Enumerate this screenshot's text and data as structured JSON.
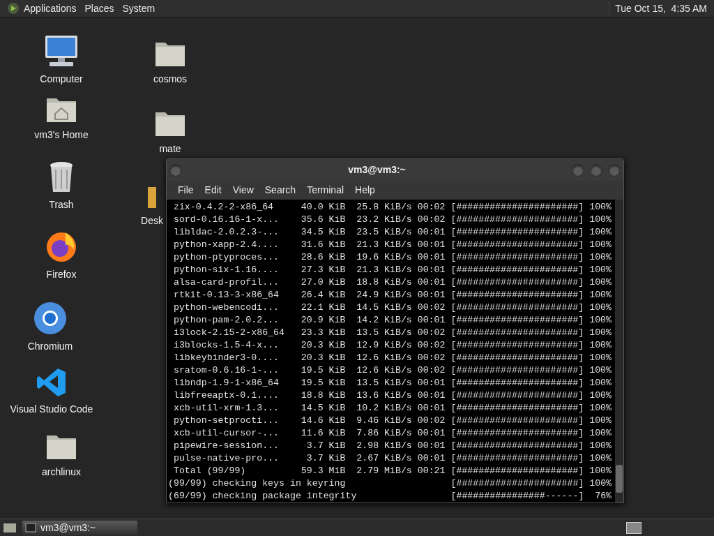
{
  "top_panel": {
    "menus": [
      "Applications",
      "Places",
      "System"
    ],
    "clock": "Tue Oct 15,  4:35 AM"
  },
  "desktop_icons": [
    {
      "label": "Computer",
      "kind": "monitor"
    },
    {
      "label": "vm3's Home",
      "kind": "home"
    },
    {
      "label": "Trash",
      "kind": "trash"
    },
    {
      "label": "Firefox",
      "kind": "flame"
    },
    {
      "label": "Chromium",
      "kind": "ring"
    },
    {
      "label": "Visual Studio Code",
      "kind": "ribbon"
    },
    {
      "label": "archlinux",
      "kind": "folder"
    },
    {
      "label": "cosmos",
      "kind": "folder"
    },
    {
      "label": "mate",
      "kind": "folder"
    },
    {
      "label": "Desk",
      "kind": "open-folder"
    }
  ],
  "terminal": {
    "title": "vm3@vm3:~",
    "menu": [
      "File",
      "Edit",
      "View",
      "Search",
      "Terminal",
      "Help"
    ],
    "rows": [
      {
        "kind": "transfer",
        "name": "zix-0.4.2-2-x86_64",
        "size": "40.0 KiB",
        "speed": "25.8 KiB/s",
        "time": "00:02",
        "bar": "[######################]",
        "percent": "100%"
      },
      {
        "kind": "transfer",
        "name": "sord-0.16.16-1-x...",
        "size": "35.6 KiB",
        "speed": "23.2 KiB/s",
        "time": "00:02",
        "bar": "[######################]",
        "percent": "100%"
      },
      {
        "kind": "transfer",
        "name": "libldac-2.0.2.3-...",
        "size": "34.5 KiB",
        "speed": "23.5 KiB/s",
        "time": "00:01",
        "bar": "[######################]",
        "percent": "100%"
      },
      {
        "kind": "transfer",
        "name": "python-xapp-2.4....",
        "size": "31.6 KiB",
        "speed": "21.3 KiB/s",
        "time": "00:01",
        "bar": "[######################]",
        "percent": "100%"
      },
      {
        "kind": "transfer",
        "name": "python-ptyproces...",
        "size": "28.6 KiB",
        "speed": "19.6 KiB/s",
        "time": "00:01",
        "bar": "[######################]",
        "percent": "100%"
      },
      {
        "kind": "transfer",
        "name": "python-six-1.16....",
        "size": "27.3 KiB",
        "speed": "21.3 KiB/s",
        "time": "00:01",
        "bar": "[######################]",
        "percent": "100%"
      },
      {
        "kind": "transfer",
        "name": "alsa-card-profil...",
        "size": "27.0 KiB",
        "speed": "18.8 KiB/s",
        "time": "00:01",
        "bar": "[######################]",
        "percent": "100%"
      },
      {
        "kind": "transfer",
        "name": "rtkit-0.13-3-x86_64",
        "size": "26.4 KiB",
        "speed": "24.9 KiB/s",
        "time": "00:01",
        "bar": "[######################]",
        "percent": "100%"
      },
      {
        "kind": "transfer",
        "name": "python-webencodi...",
        "size": "22.1 KiB",
        "speed": "14.5 KiB/s",
        "time": "00:02",
        "bar": "[######################]",
        "percent": "100%"
      },
      {
        "kind": "transfer",
        "name": "python-pam-2.0.2...",
        "size": "20.9 KiB",
        "speed": "14.2 KiB/s",
        "time": "00:01",
        "bar": "[######################]",
        "percent": "100%"
      },
      {
        "kind": "transfer",
        "name": "i3lock-2.15-2-x86_64",
        "size": "23.3 KiB",
        "speed": "13.5 KiB/s",
        "time": "00:02",
        "bar": "[######################]",
        "percent": "100%"
      },
      {
        "kind": "transfer",
        "name": "i3blocks-1.5-4-x...",
        "size": "20.3 KiB",
        "speed": "12.9 KiB/s",
        "time": "00:02",
        "bar": "[######################]",
        "percent": "100%"
      },
      {
        "kind": "transfer",
        "name": "libkeybinder3-0....",
        "size": "20.3 KiB",
        "speed": "12.6 KiB/s",
        "time": "00:02",
        "bar": "[######################]",
        "percent": "100%"
      },
      {
        "kind": "transfer",
        "name": "sratom-0.6.16-1-...",
        "size": "19.5 KiB",
        "speed": "12.6 KiB/s",
        "time": "00:02",
        "bar": "[######################]",
        "percent": "100%"
      },
      {
        "kind": "transfer",
        "name": "libndp-1.9-1-x86_64",
        "size": "19.5 KiB",
        "speed": "13.5 KiB/s",
        "time": "00:01",
        "bar": "[######################]",
        "percent": "100%"
      },
      {
        "kind": "transfer",
        "name": "libfreeaptx-0.1....",
        "size": "18.8 KiB",
        "speed": "13.6 KiB/s",
        "time": "00:01",
        "bar": "[######################]",
        "percent": "100%"
      },
      {
        "kind": "transfer",
        "name": "xcb-util-xrm-1.3...",
        "size": "14.5 KiB",
        "speed": "10.2 KiB/s",
        "time": "00:01",
        "bar": "[######################]",
        "percent": "100%"
      },
      {
        "kind": "transfer",
        "name": "python-setprocti...",
        "size": "14.6 KiB",
        "speed": "9.46 KiB/s",
        "time": "00:02",
        "bar": "[######################]",
        "percent": "100%"
      },
      {
        "kind": "transfer",
        "name": "xcb-util-cursor-...",
        "size": "11.6 KiB",
        "speed": "7.86 KiB/s",
        "time": "00:01",
        "bar": "[######################]",
        "percent": "100%"
      },
      {
        "kind": "transfer",
        "name": "pipewire-session...",
        "size": "3.7 KiB",
        "speed": "2.98 KiB/s",
        "time": "00:01",
        "bar": "[######################]",
        "percent": "100%"
      },
      {
        "kind": "transfer",
        "name": "pulse-native-pro...",
        "size": "3.7 KiB",
        "speed": "2.67 KiB/s",
        "time": "00:01",
        "bar": "[######################]",
        "percent": "100%"
      },
      {
        "kind": "transfer",
        "name": "Total (99/99)",
        "size": "59.3 MiB",
        "speed": "2.79 MiB/s",
        "time": "00:21",
        "bar": "[######################]",
        "percent": "100%"
      },
      {
        "kind": "check",
        "text": "(99/99) checking keys in keyring",
        "bar": "[######################]",
        "percent": "100%"
      },
      {
        "kind": "check",
        "text": "(69/99) checking package integrity",
        "bar": "[################------]",
        "percent": "76%"
      }
    ]
  },
  "taskbar": {
    "tasks": [
      {
        "label": "vm3@vm3:~",
        "selected": true
      }
    ]
  }
}
